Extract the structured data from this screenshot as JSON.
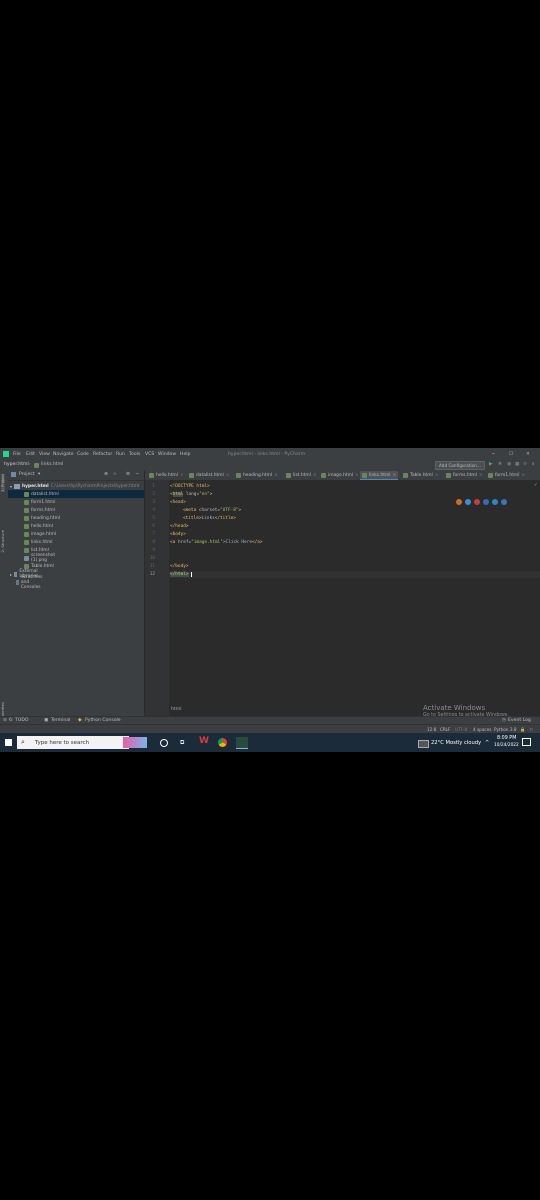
{
  "window": {
    "title": "hyper.html - links.html - PyCharm"
  },
  "menu": [
    "File",
    "Edit",
    "View",
    "Navigate",
    "Code",
    "Refactor",
    "Run",
    "Tools",
    "VCS",
    "Window",
    "Help"
  ],
  "breadcrumb": [
    "hyper.html",
    "links.html"
  ],
  "toolbar": {
    "add_config": "Add Configuration..."
  },
  "project": {
    "header": "Project",
    "root": "hyper.html",
    "root_path": "C:\\Users\\hp\\PycharmProjects\\hyper.html",
    "files": [
      "datalist.html",
      "form1.html",
      "forms.html",
      "heading.html",
      "hello.html",
      "image.html",
      "links.html",
      "list.html",
      "screenshot (1).png",
      "Table.html"
    ],
    "extra": [
      "External Libraries",
      "Scratches and Consoles"
    ]
  },
  "tabs": [
    "hello.html",
    "datalist.html",
    "heading.html",
    "list.html",
    "image.html",
    "links.html",
    "Table.html",
    "forms.html",
    "form1.html"
  ],
  "editor": {
    "line_numbers": [
      "1",
      "2",
      "3",
      "4",
      "5",
      "6",
      "7",
      "8",
      "9",
      "10",
      "11",
      "12"
    ],
    "lines": {
      "l1": "<!DOCTYPE html>",
      "l2_tag": "html",
      "l2_attr": " lang=",
      "l2_val": "\"en\"",
      "l3": "<head>",
      "l4_tag": "<meta",
      "l4_attr": " charset=",
      "l4_val": "\"UTF-8\"",
      "l5_open": "<title>",
      "l5_text": "Links",
      "l5_close": "</title>",
      "l6": "</head>",
      "l7": "<body>",
      "l8_tag": "<a",
      "l8_attr": " href=",
      "l8_val": "\"image.html\"",
      "l8_text": ">Click Here",
      "l8_close": "</a>",
      "l11": "</body>",
      "l12": "</html>"
    },
    "footer_crumb": "html"
  },
  "left_tools": [
    "1: Project",
    "2: Structure",
    "2: Favorites"
  ],
  "bottom_tools": [
    "6: TODO",
    "Terminal",
    "Python Console"
  ],
  "event_log": "Event Log",
  "status": {
    "position": "12:8",
    "line_sep": "CRLF",
    "encoding": "UTF-8",
    "indent": "4 spaces",
    "interpreter": "Python 3.8"
  },
  "activate": {
    "title": "Activate Windows",
    "sub": "Go to Settings to activate Windows."
  },
  "taskbar": {
    "search_placeholder": "Type here to search",
    "weather": "22°C  Mostly cloudy",
    "time": "8:09 PM",
    "date": "10/24/2022"
  }
}
